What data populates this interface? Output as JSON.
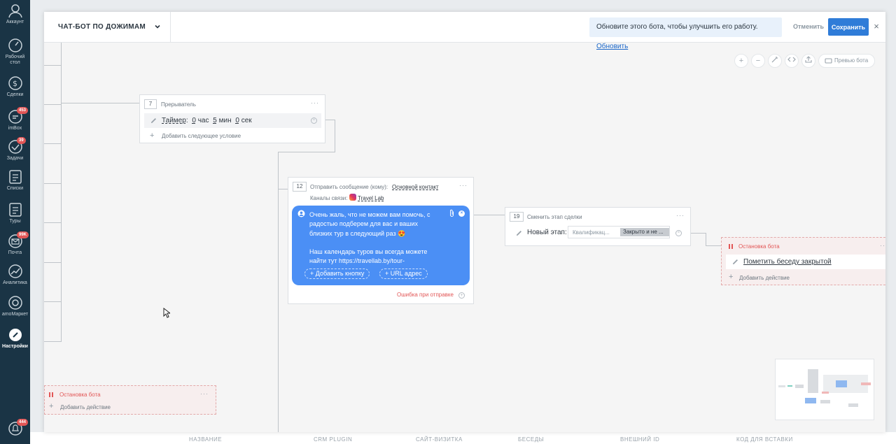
{
  "sidebar": {
    "items": [
      {
        "label": "Аккаунт",
        "badge": ""
      },
      {
        "label": "Рабочий стол",
        "badge": ""
      },
      {
        "label": "Сделки",
        "badge": ""
      },
      {
        "label": "imBox",
        "badge": "453"
      },
      {
        "label": "Задачи",
        "badge": "39"
      },
      {
        "label": "Списки",
        "badge": ""
      },
      {
        "label": "Туры",
        "badge": ""
      },
      {
        "label": "Почта",
        "badge": "99K"
      },
      {
        "label": "Аналитика",
        "badge": ""
      },
      {
        "label": "amoМаркет",
        "badge": ""
      },
      {
        "label": "Настройки",
        "badge": ""
      },
      {
        "label": "",
        "badge": "444"
      }
    ]
  },
  "background_table": {
    "columns": [
      "НАЗВАНИЕ",
      "CRM PLUGIN",
      "САЙТ-ВИЗИТКА",
      "БЕСЕДЫ",
      "ВНЕШНИЙ ID",
      "КОД ДЛЯ ВСТАВКИ"
    ]
  },
  "header": {
    "title": "ЧАТ-БОТ ПО ДОЖИМАМ",
    "notice": "Обновите этого бота, чтобы улучшить его работу.",
    "notice_link": "Обновить",
    "cancel": "Отменить",
    "save": "Сохранить",
    "close": "×"
  },
  "toolbar": {
    "zoom_in": "+",
    "zoom_out": "−",
    "preview": "Превью бота"
  },
  "blocks": {
    "interrupter": {
      "number": "7",
      "title": "Прерыватель",
      "timer_label": "Таймер",
      "hours": "0",
      "hours_unit": "час",
      "minutes": "5",
      "minutes_unit": "мин",
      "seconds": "0",
      "seconds_unit": "сек",
      "add_condition": "Добавить следующее условие"
    },
    "send_message": {
      "number": "12",
      "title": "Отправить сообщение (кому):",
      "recipient": "Основной контакт",
      "channels_label": "Каналы связи:",
      "channel": "Travel Lab",
      "message": "Очень жаль, что не можем вам помочь, с радостью подберем для вас и ваших близких тур в следующий раз 😍\n\nНаш календарь туров вы всегда можете найти тут https://travellab.by/tour-",
      "add_button": "Добавить кнопку",
      "url_button": "URL адрес",
      "error_label": "Ошибка при отправке"
    },
    "change_stage": {
      "number": "19",
      "title": "Сменить этап сделки",
      "stage_label": "Новый этап:",
      "stage_value_1": "Квалификац...",
      "stage_value_2": "Закрыто и не ..."
    },
    "stop_bot_right": {
      "title": "Остановка бота",
      "action": "Пометить беседу закрытой",
      "add_action": "Добавить действие"
    },
    "stop_bot_left": {
      "title": "Остановка бота",
      "add_action": "Добавить действие"
    }
  },
  "colors": {
    "sidebar_bg": "#1a3445",
    "accent_blue": "#2f7cd8",
    "bubble_blue": "#4b8ff5",
    "stop_red": "#e25656"
  }
}
